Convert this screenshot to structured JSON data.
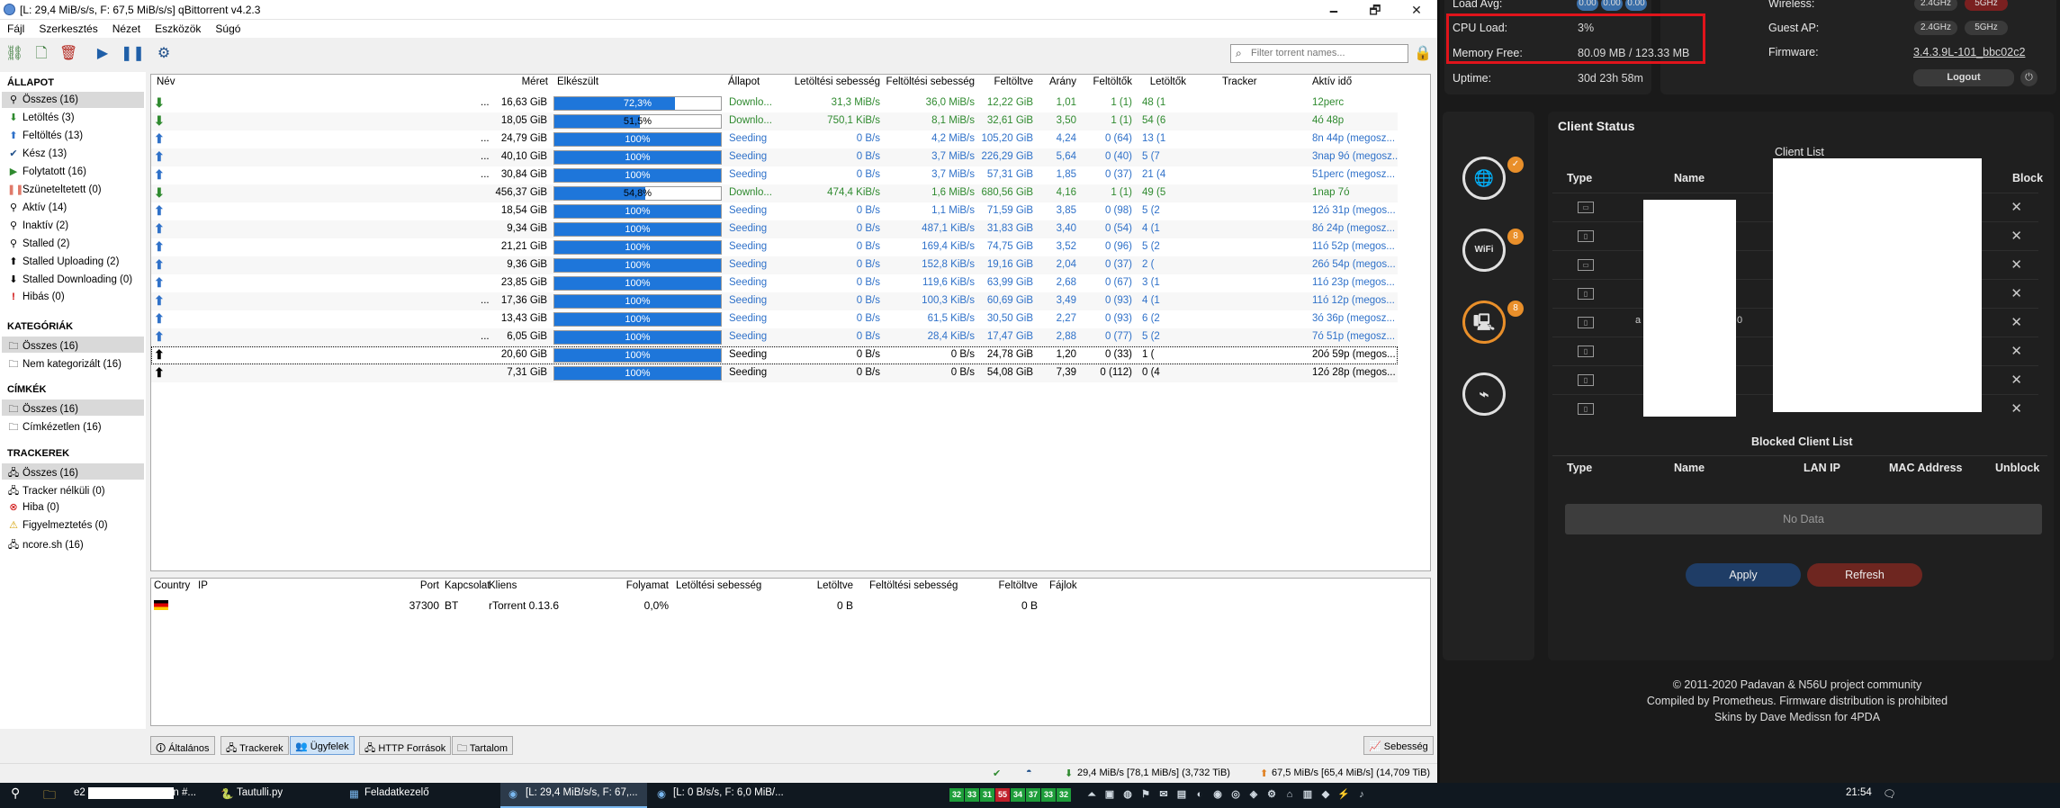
{
  "window": {
    "title": "[L: 29,4 MiB/s/s, F: 67,5 MiB/s/s] qBittorrent v4.2.3",
    "minimize": "🗕",
    "maximize": "🗗",
    "close": "✕"
  },
  "menu": [
    "Fájl",
    "Szerkesztés",
    "Nézet",
    "Eszközök",
    "Súgó"
  ],
  "toolbar": {
    "icons": [
      "add-torrent-link-icon",
      "add-torrent-file-icon",
      "delete-icon",
      "resume-icon",
      "pause-icon",
      "options-gear-icon"
    ],
    "search_placeholder": "Filter torrent names..."
  },
  "sidebar": {
    "status_header": "ÁLLAPOT",
    "status": [
      "Összes (16)",
      "Letöltés (3)",
      "Feltöltés (13)",
      "Kész (13)",
      "Folytatott (16)",
      "Szüneteltetett (0)",
      "Aktív (14)",
      "Inaktív (2)",
      "Stalled (2)",
      "Stalled Uploading (2)",
      "Stalled Downloading (0)",
      "Hibás (0)"
    ],
    "categories_header": "KATEGÓRIÁK",
    "categories": [
      "Összes (16)",
      "Nem kategorizált (16)"
    ],
    "tags_header": "CÍMKÉK",
    "tags": [
      "Összes (16)",
      "Címkézetlen (16)"
    ],
    "trackers_header": "TRACKEREK",
    "trackers": [
      "Összes (16)",
      "Tracker nélküli (0)",
      "Hiba (0)",
      "Figyelmeztetés (0)",
      "ncore.sh (16)"
    ]
  },
  "torrent_table": {
    "headers": [
      "Név",
      "Méret",
      "Elkészült",
      "Állapot",
      "Letöltési sebesség",
      "Feltöltési sebesség",
      "Feltöltve",
      "Arány",
      "Feltöltők",
      "Letöltők",
      "Tracker",
      "Aktív idő"
    ],
    "rows": [
      {
        "kind": "dl",
        "name": "...",
        "size": "16,63 GiB",
        "progress": 72.3,
        "progress_label": "72,3%",
        "state": "Downlo...",
        "dl": "31,3 MiB/s",
        "ul": "36,0 MiB/s",
        "uploaded": "12,22 GiB",
        "ratio": "1,01",
        "seeds": "1 (1)",
        "peers": "48 (1",
        "active": "12perc"
      },
      {
        "kind": "dl",
        "name": "",
        "size": "18,05 GiB",
        "progress": 51.5,
        "progress_label": "51,5%",
        "state": "Downlo...",
        "dl": "750,1 KiB/s",
        "ul": "8,1 MiB/s",
        "uploaded": "32,61 GiB",
        "ratio": "3,50",
        "seeds": "1 (1)",
        "peers": "54 (6",
        "active": "4ó 48p"
      },
      {
        "kind": "up",
        "name": "...",
        "size": "24,79 GiB",
        "progress": 100,
        "progress_label": "100%",
        "state": "Seeding",
        "dl": "0 B/s",
        "ul": "4,2 MiB/s",
        "uploaded": "105,20 GiB",
        "ratio": "4,24",
        "seeds": "0 (64)",
        "peers": "13 (1",
        "active": "8n 44p (megosz..."
      },
      {
        "kind": "up",
        "name": "...",
        "size": "40,10 GiB",
        "progress": 100,
        "progress_label": "100%",
        "state": "Seeding",
        "dl": "0 B/s",
        "ul": "3,7 MiB/s",
        "uploaded": "226,29 GiB",
        "ratio": "5,64",
        "seeds": "0 (40)",
        "peers": "5 (7",
        "active": "3nap 9ó (megosz..."
      },
      {
        "kind": "up",
        "name": "...",
        "size": "30,84 GiB",
        "progress": 100,
        "progress_label": "100%",
        "state": "Seeding",
        "dl": "0 B/s",
        "ul": "3,7 MiB/s",
        "uploaded": "57,31 GiB",
        "ratio": "1,85",
        "seeds": "0 (37)",
        "peers": "21 (4",
        "active": "51perc (megosz..."
      },
      {
        "kind": "dl",
        "name": "",
        "size": "456,37 GiB",
        "progress": 54.8,
        "progress_label": "54,8%",
        "state": "Downlo...",
        "dl": "474,4 KiB/s",
        "ul": "1,6 MiB/s",
        "uploaded": "680,56 GiB",
        "ratio": "4,16",
        "seeds": "1 (1)",
        "peers": "49 (5",
        "active": "1nap 7ó"
      },
      {
        "kind": "up",
        "name": "",
        "size": "18,54 GiB",
        "progress": 100,
        "progress_label": "100%",
        "state": "Seeding",
        "dl": "0 B/s",
        "ul": "1,1 MiB/s",
        "uploaded": "71,59 GiB",
        "ratio": "3,85",
        "seeds": "0 (98)",
        "peers": "5 (2",
        "active": "12ó 31p (megos..."
      },
      {
        "kind": "up",
        "name": "",
        "size": "9,34 GiB",
        "progress": 100,
        "progress_label": "100%",
        "state": "Seeding",
        "dl": "0 B/s",
        "ul": "487,1 KiB/s",
        "uploaded": "31,83 GiB",
        "ratio": "3,40",
        "seeds": "0 (54)",
        "peers": "4 (1",
        "active": "8ó 24p (megosz..."
      },
      {
        "kind": "up",
        "name": "",
        "size": "21,21 GiB",
        "progress": 100,
        "progress_label": "100%",
        "state": "Seeding",
        "dl": "0 B/s",
        "ul": "169,4 KiB/s",
        "uploaded": "74,75 GiB",
        "ratio": "3,52",
        "seeds": "0 (96)",
        "peers": "5 (2",
        "active": "11ó 52p (megos..."
      },
      {
        "kind": "up",
        "name": "",
        "size": "9,36 GiB",
        "progress": 100,
        "progress_label": "100%",
        "state": "Seeding",
        "dl": "0 B/s",
        "ul": "152,8 KiB/s",
        "uploaded": "19,16 GiB",
        "ratio": "2,04",
        "seeds": "0 (37)",
        "peers": "2 (",
        "active": "26ó 54p (megos..."
      },
      {
        "kind": "up",
        "name": "",
        "size": "23,85 GiB",
        "progress": 100,
        "progress_label": "100%",
        "state": "Seeding",
        "dl": "0 B/s",
        "ul": "119,6 KiB/s",
        "uploaded": "63,99 GiB",
        "ratio": "2,68",
        "seeds": "0 (67)",
        "peers": "3 (1",
        "active": "11ó 23p (megos..."
      },
      {
        "kind": "up",
        "name": "...",
        "size": "17,36 GiB",
        "progress": 100,
        "progress_label": "100%",
        "state": "Seeding",
        "dl": "0 B/s",
        "ul": "100,3 KiB/s",
        "uploaded": "60,69 GiB",
        "ratio": "3,49",
        "seeds": "0 (93)",
        "peers": "4 (1",
        "active": "11ó 12p (megos..."
      },
      {
        "kind": "up",
        "name": "",
        "size": "13,43 GiB",
        "progress": 100,
        "progress_label": "100%",
        "state": "Seeding",
        "dl": "0 B/s",
        "ul": "61,5 KiB/s",
        "uploaded": "30,50 GiB",
        "ratio": "2,27",
        "seeds": "0 (93)",
        "peers": "6 (2",
        "active": "3ó 36p (megosz..."
      },
      {
        "kind": "up",
        "name": "...",
        "size": "6,05 GiB",
        "progress": 100,
        "progress_label": "100%",
        "state": "Seeding",
        "dl": "0 B/s",
        "ul": "28,4 KiB/s",
        "uploaded": "17,47 GiB",
        "ratio": "2,88",
        "seeds": "0 (77)",
        "peers": "5 (2",
        "active": "7ó 51p (megosz..."
      },
      {
        "kind": "st",
        "name": "",
        "size": "20,60 GiB",
        "progress": 100,
        "progress_label": "100%",
        "state": "Seeding",
        "dl": "0 B/s",
        "ul": "0 B/s",
        "uploaded": "24,78 GiB",
        "ratio": "1,20",
        "seeds": "0 (33)",
        "peers": "1 (",
        "active": "20ó 59p (megos..."
      },
      {
        "kind": "st",
        "name": "",
        "size": "7,31 GiB",
        "progress": 100,
        "progress_label": "100%",
        "state": "Seeding",
        "dl": "0 B/s",
        "ul": "0 B/s",
        "uploaded": "54,08 GiB",
        "ratio": "7,39",
        "seeds": "0 (112)",
        "peers": "0 (4",
        "active": "12ó 28p (megos..."
      }
    ]
  },
  "peers_table": {
    "headers": [
      "Country",
      "IP",
      "Port",
      "Kapcsolat",
      "Kliens",
      "Folyamat",
      "Letöltési sebesség",
      "Letöltve",
      "Feltöltési sebesség",
      "Feltöltve",
      "Fájlok"
    ],
    "row": {
      "country_flag": "de-flag-icon",
      "ip": "",
      "port": "37300",
      "conn": "BT",
      "client": "rTorrent 0.13.6",
      "progress": "0,0%",
      "dl_speed": "",
      "downloaded": "0 B",
      "ul_speed": "",
      "uploaded": "0 B",
      "files": ""
    }
  },
  "bottom_tabs": [
    "Általános",
    "Trackerek",
    "Ügyfelek",
    "HTTP Források",
    "Tartalom"
  ],
  "speed_button": "Sebesség",
  "statusbar": {
    "dl": "29,4 MiB/s [78,1 MiB/s] (3,732 TiB)",
    "ul": "67,5 MiB/s [65,4 MiB/s] (14,709 TiB)"
  },
  "router": {
    "load_avg_label": "Load Avg:",
    "load_avg": [
      "0.00",
      "0.00",
      "0.00"
    ],
    "cpu_label": "CPU Load:",
    "cpu_value": "3%",
    "mem_label": "Memory Free:",
    "mem_value": "80.09 MB / 123.33 MB",
    "uptime_label": "Uptime:",
    "uptime_value": "30d 23h 58m",
    "wireless_label": "Wireless:",
    "guest_label": "Guest AP:",
    "firmware_label": "Firmware:",
    "firmware_value": "3.4.3.9L-101_bbc02c2",
    "band_24": "2.4GHz",
    "band_5": "5GHz",
    "logout": "Logout",
    "client_status_title": "Client Status",
    "client_list_title": "Client List",
    "client_headers": [
      "Type",
      "Name",
      "Block"
    ],
    "client_row_fragment_a": "a",
    "client_row_fragment_b": "0",
    "blocked_title": "Blocked Client List",
    "blocked_headers": [
      "Type",
      "Name",
      "LAN IP",
      "MAC Address",
      "Unblock"
    ],
    "no_data": "No Data",
    "apply": "Apply",
    "refresh": "Refresh",
    "footer": [
      "© 2011-2020 Padavan & N56U project community",
      "Compiled by Prometheus. Firmware distribution is prohibited",
      "Skins by Dave Medissn for 4PDA"
    ],
    "highlight_color": "#e0141b",
    "badges": [
      "✓",
      "8",
      "8"
    ]
  },
  "taskbar": {
    "items": [
      "e2",
      "on #...",
      "Tautulli.py",
      "Feladatkezelő",
      "[L: 29,4 MiB/s/s, F: 67,...",
      "[L: 0 B/s/s, F: 6,0 MiB/..."
    ],
    "tray_numbers": [
      "32",
      "33",
      "31",
      "55",
      "34",
      "37",
      "33",
      "32"
    ],
    "time": "21:54"
  }
}
